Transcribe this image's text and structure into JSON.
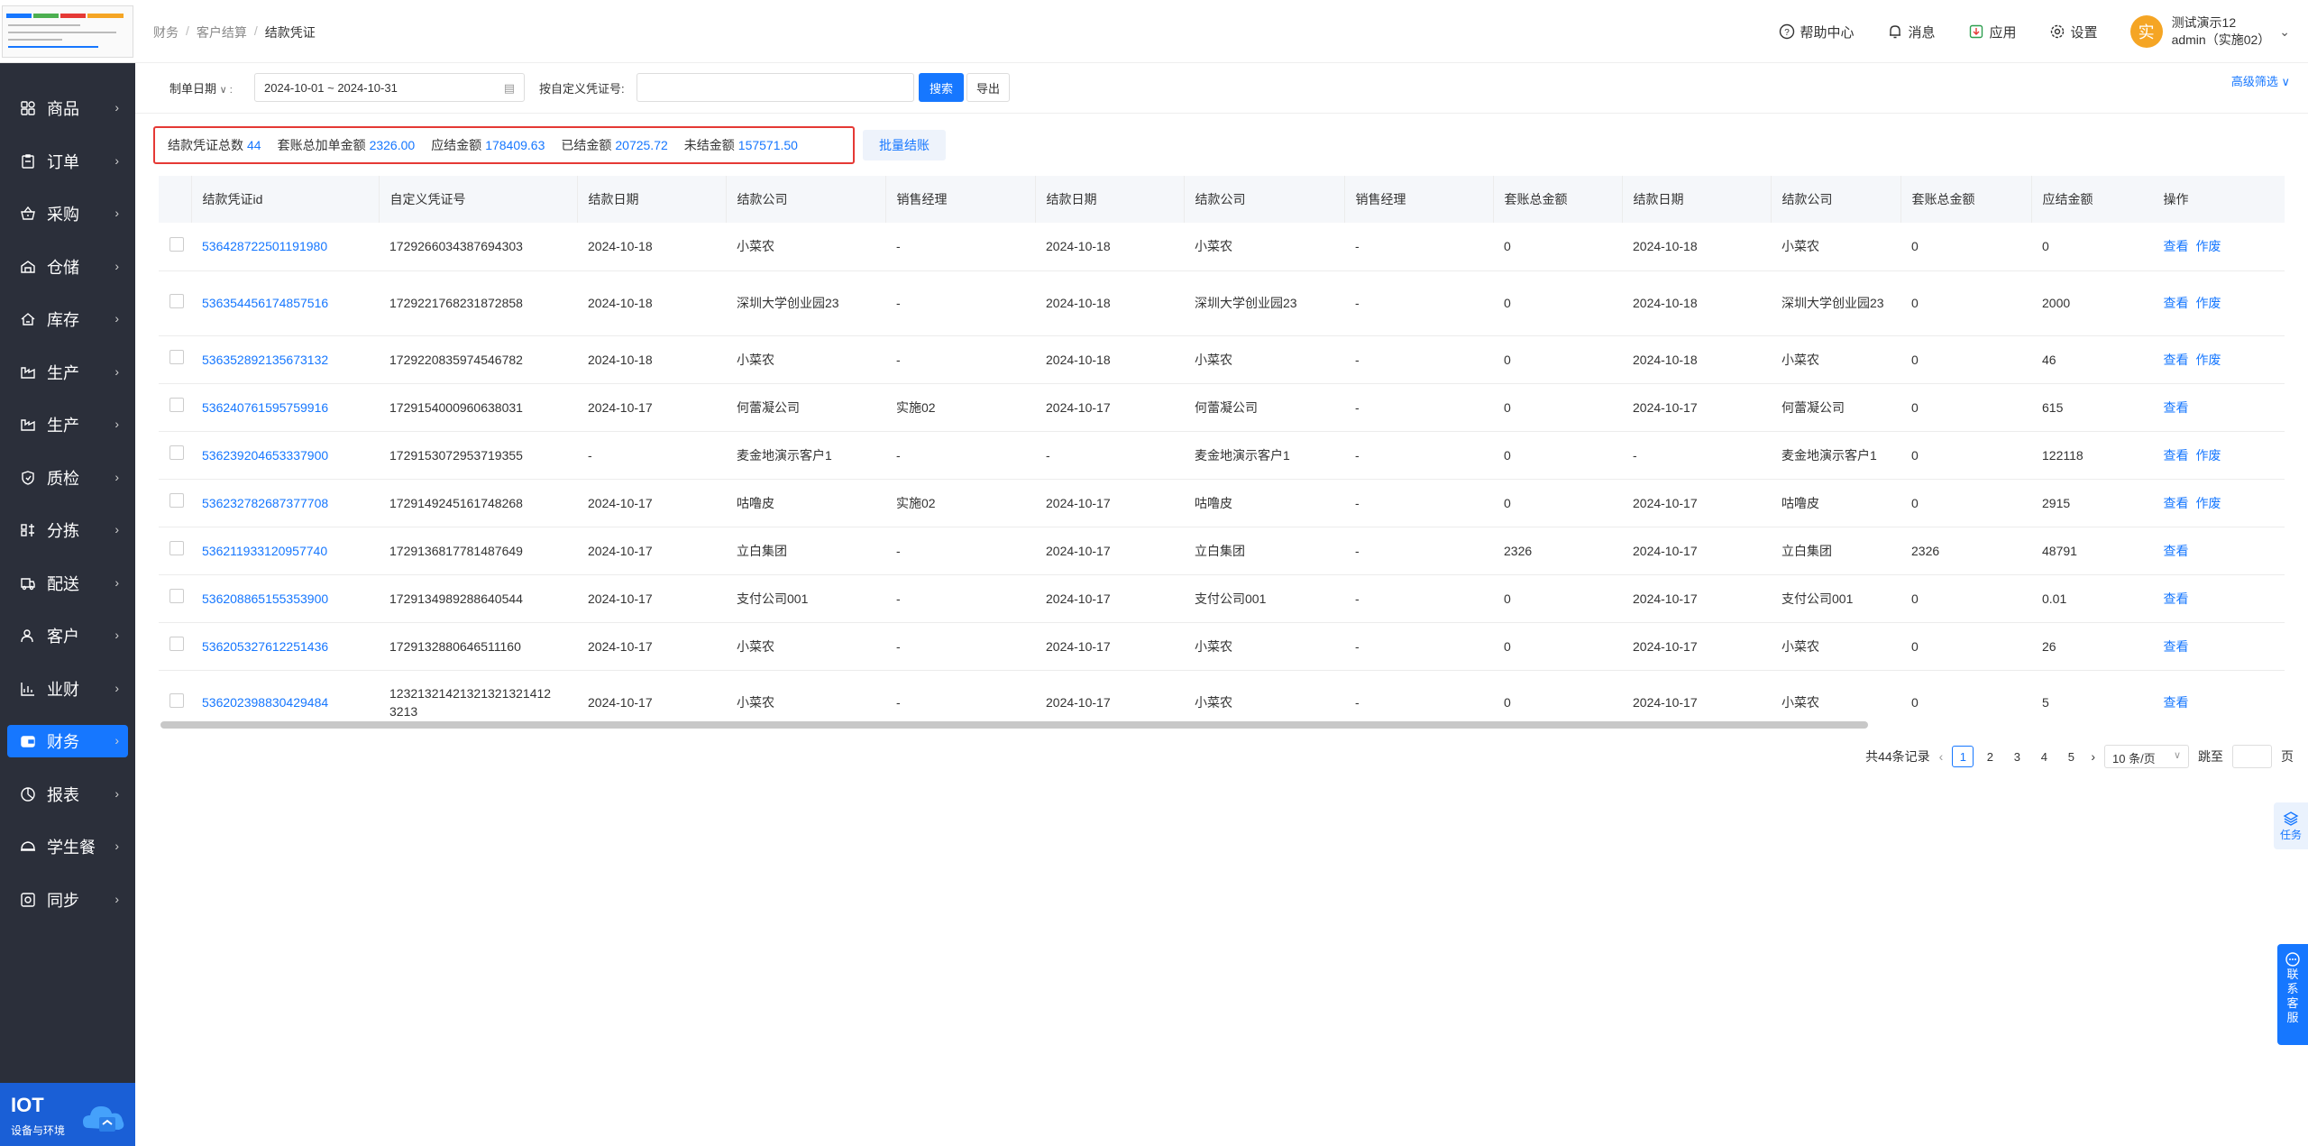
{
  "sidebar": {
    "menu": [
      {
        "label": "商品",
        "icon": "grid-icon"
      },
      {
        "label": "订单",
        "icon": "clipboard-icon"
      },
      {
        "label": "采购",
        "icon": "basket-icon"
      },
      {
        "label": "仓储",
        "icon": "warehouse-icon"
      },
      {
        "label": "库存",
        "icon": "home-icon"
      },
      {
        "label": "生产",
        "icon": "factory-icon"
      },
      {
        "label": "生产",
        "icon": "factory-icon"
      },
      {
        "label": "质检",
        "icon": "shield-icon"
      },
      {
        "label": "分拣",
        "icon": "sort-icon"
      },
      {
        "label": "配送",
        "icon": "truck-icon"
      },
      {
        "label": "客户",
        "icon": "user-icon"
      },
      {
        "label": "业财",
        "icon": "chart-icon"
      },
      {
        "label": "财务",
        "icon": "wallet-icon",
        "active": true
      },
      {
        "label": "报表",
        "icon": "pie-icon"
      },
      {
        "label": "学生餐",
        "icon": "hat-icon"
      },
      {
        "label": "同步",
        "icon": "sync-icon"
      }
    ],
    "iot": {
      "title": "IOT",
      "subtitle": "设备与环境"
    }
  },
  "header": {
    "breadcrumb": [
      "财务",
      "客户结算",
      "结款凭证"
    ],
    "help": "帮助中心",
    "messages": "消息",
    "apps": "应用",
    "settings": "设置",
    "user": {
      "avatar": "实",
      "name": "测试演示12",
      "account": "admin（实施02）"
    }
  },
  "filter": {
    "date_type": "制单日期",
    "date_range": "2024-10-01 ~ 2024-10-31",
    "voucher_label": "按自定义凭证号:",
    "voucher_value": "",
    "search": "搜索",
    "export": "导出",
    "advanced": "高级筛选"
  },
  "summary": {
    "total_count_label": "结款凭证总数",
    "total_count": "44",
    "package_label": "套账总加单金额",
    "package_amount": "2326.00",
    "due_label": "应结金额",
    "due_amount": "178409.63",
    "settled_label": "已结金额",
    "settled_amount": "20725.72",
    "unsettled_label": "未结金额",
    "unsettled_amount": "157571.50",
    "batch_button": "批量结账"
  },
  "table": {
    "columns": [
      "结款凭证id",
      "自定义凭证号",
      "结款日期",
      "结款公司",
      "销售经理",
      "结款日期",
      "结款公司",
      "销售经理",
      "套账总金额",
      "结款日期",
      "结款公司",
      "套账总金额",
      "应结金额",
      "操作"
    ],
    "rows": [
      {
        "id": "536428722501191980",
        "voucher": "1729266034387694303",
        "date1": "2024-10-18",
        "company1": "小菜农",
        "manager1": "-",
        "date2": "2024-10-18",
        "company2": "小菜农",
        "manager2": "-",
        "package1": "0",
        "date3": "2024-10-18",
        "company3": "小菜农",
        "package2": "0",
        "due": "0",
        "ops": [
          "查看",
          "作废"
        ]
      },
      {
        "id": "536354456174857516",
        "voucher": "1729221768231872858",
        "date1": "2024-10-18",
        "company1": "深圳大学创业园23",
        "manager1": "-",
        "date2": "2024-10-18",
        "company2": "深圳大学创业园23",
        "manager2": "-",
        "package1": "0",
        "date3": "2024-10-18",
        "company3": "深圳大学创业园23",
        "package2": "0",
        "due": "2000",
        "ops": [
          "查看",
          "作废"
        ]
      },
      {
        "id": "536352892135673132",
        "voucher": "1729220835974546782",
        "date1": "2024-10-18",
        "company1": "小菜农",
        "manager1": "-",
        "date2": "2024-10-18",
        "company2": "小菜农",
        "manager2": "-",
        "package1": "0",
        "date3": "2024-10-18",
        "company3": "小菜农",
        "package2": "0",
        "due": "46",
        "ops": [
          "查看",
          "作废"
        ]
      },
      {
        "id": "536240761595759916",
        "voucher": "1729154000960638031",
        "date1": "2024-10-17",
        "company1": "何蕾凝公司",
        "manager1": "实施02",
        "date2": "2024-10-17",
        "company2": "何蕾凝公司",
        "manager2": "-",
        "package1": "0",
        "date3": "2024-10-17",
        "company3": "何蕾凝公司",
        "package2": "0",
        "due": "615",
        "ops": [
          "查看"
        ]
      },
      {
        "id": "536239204653337900",
        "voucher": "1729153072953719355",
        "date1": "-",
        "company1": "麦金地演示客户1",
        "manager1": "-",
        "date2": "-",
        "company2": "麦金地演示客户1",
        "manager2": "-",
        "package1": "0",
        "date3": "-",
        "company3": "麦金地演示客户1",
        "package2": "0",
        "due": "122118",
        "ops": [
          "查看",
          "作废"
        ]
      },
      {
        "id": "536232782687377708",
        "voucher": "1729149245161748268",
        "date1": "2024-10-17",
        "company1": "咕噜皮",
        "manager1": "实施02",
        "date2": "2024-10-17",
        "company2": "咕噜皮",
        "manager2": "-",
        "package1": "0",
        "date3": "2024-10-17",
        "company3": "咕噜皮",
        "package2": "0",
        "due": "2915",
        "ops": [
          "查看",
          "作废"
        ]
      },
      {
        "id": "536211933120957740",
        "voucher": "1729136817781487649",
        "date1": "2024-10-17",
        "company1": "立白集团",
        "manager1": "-",
        "date2": "2024-10-17",
        "company2": "立白集团",
        "manager2": "-",
        "package1": "2326",
        "date3": "2024-10-17",
        "company3": "立白集团",
        "package2": "2326",
        "due": "48791",
        "ops": [
          "查看"
        ]
      },
      {
        "id": "536208865155353900",
        "voucher": "1729134989288640544",
        "date1": "2024-10-17",
        "company1": "支付公司001",
        "manager1": "-",
        "date2": "2024-10-17",
        "company2": "支付公司001",
        "manager2": "-",
        "package1": "0",
        "date3": "2024-10-17",
        "company3": "支付公司001",
        "package2": "0",
        "due": "0.01",
        "ops": [
          "查看"
        ]
      },
      {
        "id": "536205327612251436",
        "voucher": "1729132880646511160",
        "date1": "2024-10-17",
        "company1": "小菜农",
        "manager1": "-",
        "date2": "2024-10-17",
        "company2": "小菜农",
        "manager2": "-",
        "package1": "0",
        "date3": "2024-10-17",
        "company3": "小菜农",
        "package2": "0",
        "due": "26",
        "ops": [
          "查看"
        ]
      },
      {
        "id": "536202398830429484",
        "voucher": "12321321421321321321412 3213",
        "date1": "2024-10-17",
        "company1": "小菜农",
        "manager1": "-",
        "date2": "2024-10-17",
        "company2": "小菜农",
        "manager2": "-",
        "package1": "0",
        "date3": "2024-10-17",
        "company3": "小菜农",
        "package2": "0",
        "due": "5",
        "ops": [
          "查看"
        ]
      }
    ]
  },
  "pagination": {
    "total": "共44条记录",
    "pages": [
      "1",
      "2",
      "3",
      "4",
      "5"
    ],
    "current": "1",
    "page_size": "10 条/页",
    "goto": "跳至",
    "page_suffix": "页"
  },
  "floating": {
    "task": "任务",
    "customer_service": [
      "联",
      "系",
      "客",
      "服"
    ]
  },
  "colors": {
    "primary": "#1677ff",
    "sidebar": "#2b2f3a",
    "highlight_border": "#e53935"
  }
}
